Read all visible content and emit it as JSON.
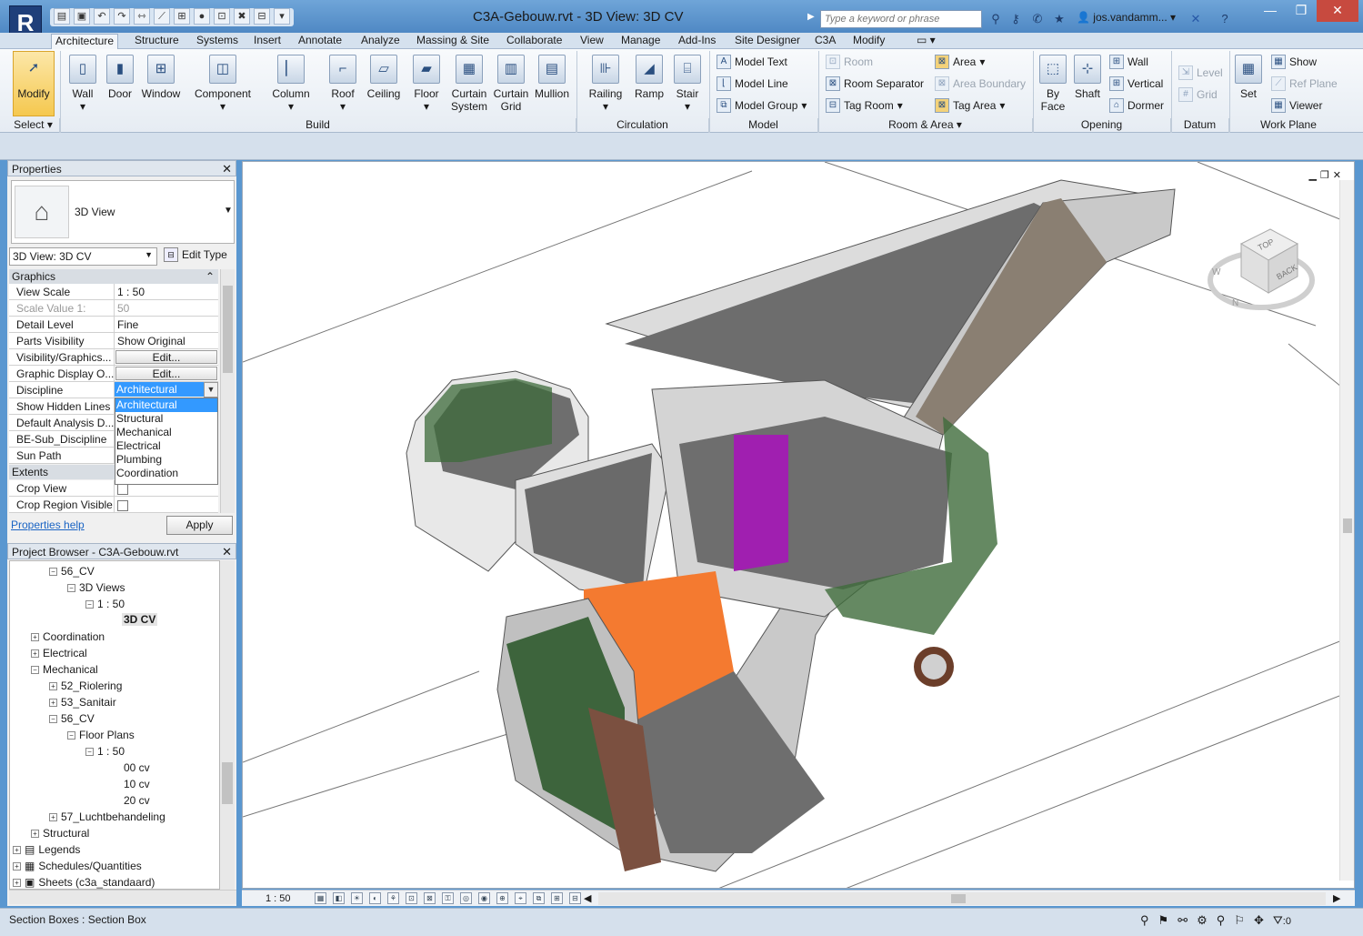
{
  "app": {
    "logo": "R",
    "title": "C3A-Gebouw.rvt - 3D View: 3D CV"
  },
  "search": {
    "placeholder": "Type a keyword or phrase"
  },
  "user": {
    "name": "jos.vandamm..."
  },
  "tabs": [
    "Architecture",
    "Structure",
    "Systems",
    "Insert",
    "Annotate",
    "Analyze",
    "Massing & Site",
    "Collaborate",
    "View",
    "Manage",
    "Add-Ins",
    "Site Designer",
    "C3A",
    "Modify"
  ],
  "ribbon": {
    "select": {
      "modify": "Modify",
      "select_label": "Select"
    },
    "build": [
      "Wall",
      "Door",
      "Window",
      "Component",
      "Column",
      "Roof",
      "Ceiling",
      "Floor",
      "Curtain System",
      "Curtain Grid",
      "Mullion"
    ],
    "build_label": "Build",
    "circulation": [
      "Railing",
      "Ramp",
      "Stair"
    ],
    "circulation_label": "Circulation",
    "model": [
      "Model Text",
      "Model Line",
      "Model Group"
    ],
    "model_label": "Model",
    "room_left": [
      "Room",
      "Room Separator",
      "Tag Room"
    ],
    "room_right": [
      "Area",
      "Area Boundary",
      "Tag Area"
    ],
    "room_label": "Room & Area",
    "opening_big": [
      "By Face",
      "Shaft"
    ],
    "opening_small": [
      "Wall",
      "Vertical",
      "Dormer"
    ],
    "opening_label": "Opening",
    "datum": [
      "Level",
      "Grid"
    ],
    "datum_label": "Datum",
    "workplane_big": "Set",
    "workplane_small": [
      "Show",
      "Ref Plane",
      "Viewer"
    ],
    "workplane_label": "Work Plane"
  },
  "properties": {
    "header": "Properties",
    "type_name": "3D View",
    "view_selector": "3D View: 3D CV",
    "edit_type": "Edit Type",
    "group_graphics": "Graphics",
    "group_extents": "Extents",
    "rows": [
      {
        "k": "View Scale",
        "v": "1 : 50"
      },
      {
        "k": "Scale Value    1:",
        "v": "50"
      },
      {
        "k": "Detail Level",
        "v": "Fine"
      },
      {
        "k": "Parts Visibility",
        "v": "Show Original"
      },
      {
        "k": "Visibility/Graphics...",
        "v": "Edit..."
      },
      {
        "k": "Graphic Display O...",
        "v": "Edit..."
      },
      {
        "k": "Discipline",
        "v": "Architectural"
      },
      {
        "k": "Show Hidden Lines",
        "v": ""
      },
      {
        "k": "Default Analysis D...",
        "v": ""
      },
      {
        "k": "BE-Sub_Discipline",
        "v": ""
      },
      {
        "k": "Sun Path",
        "v": ""
      }
    ],
    "extent_rows": [
      {
        "k": "Crop View",
        "v": ""
      },
      {
        "k": "Crop Region Visible",
        "v": ""
      }
    ],
    "discipline_options": [
      "Architectural",
      "Structural",
      "Mechanical",
      "Electrical",
      "Plumbing",
      "Coordination"
    ],
    "help_link": "Properties help",
    "apply": "Apply"
  },
  "browser": {
    "header": "Project Browser - C3A-Gebouw.rvt",
    "nodes": [
      {
        "label": "56_CV",
        "toggle": "−"
      },
      {
        "label": "3D Views",
        "toggle": "−"
      },
      {
        "label": "1 : 50",
        "toggle": "−"
      },
      {
        "label": "3D CV",
        "toggle": ""
      },
      {
        "label": "Coordination",
        "toggle": "+"
      },
      {
        "label": "Electrical",
        "toggle": "+"
      },
      {
        "label": "Mechanical",
        "toggle": "−"
      },
      {
        "label": "52_Riolering",
        "toggle": "+"
      },
      {
        "label": "53_Sanitair",
        "toggle": "+"
      },
      {
        "label": "56_CV",
        "toggle": "−"
      },
      {
        "label": "Floor Plans",
        "toggle": "−"
      },
      {
        "label": "1 : 50",
        "toggle": "−"
      },
      {
        "label": "00 cv",
        "toggle": ""
      },
      {
        "label": "10 cv",
        "toggle": ""
      },
      {
        "label": "20 cv",
        "toggle": ""
      },
      {
        "label": "57_Luchtbehandeling",
        "toggle": "+"
      },
      {
        "label": "Structural",
        "toggle": "+"
      },
      {
        "label": "Legends",
        "toggle": "+"
      },
      {
        "label": "Schedules/Quantities",
        "toggle": "+"
      },
      {
        "label": "Sheets (c3a_standaard)",
        "toggle": "+"
      }
    ]
  },
  "viewport": {
    "scale": "1 : 50",
    "viewcube_top": "TOP",
    "viewcube_back": "BACK",
    "compass": [
      "W",
      "N"
    ]
  },
  "status": {
    "text": "Section Boxes : Section Box",
    "filter_count": ":0"
  },
  "colors": {
    "accent_orange": "#f47a30",
    "glass_green": "#3e6b3b",
    "purple": "#a01fb0",
    "floor_grey": "#6e6e6e"
  }
}
